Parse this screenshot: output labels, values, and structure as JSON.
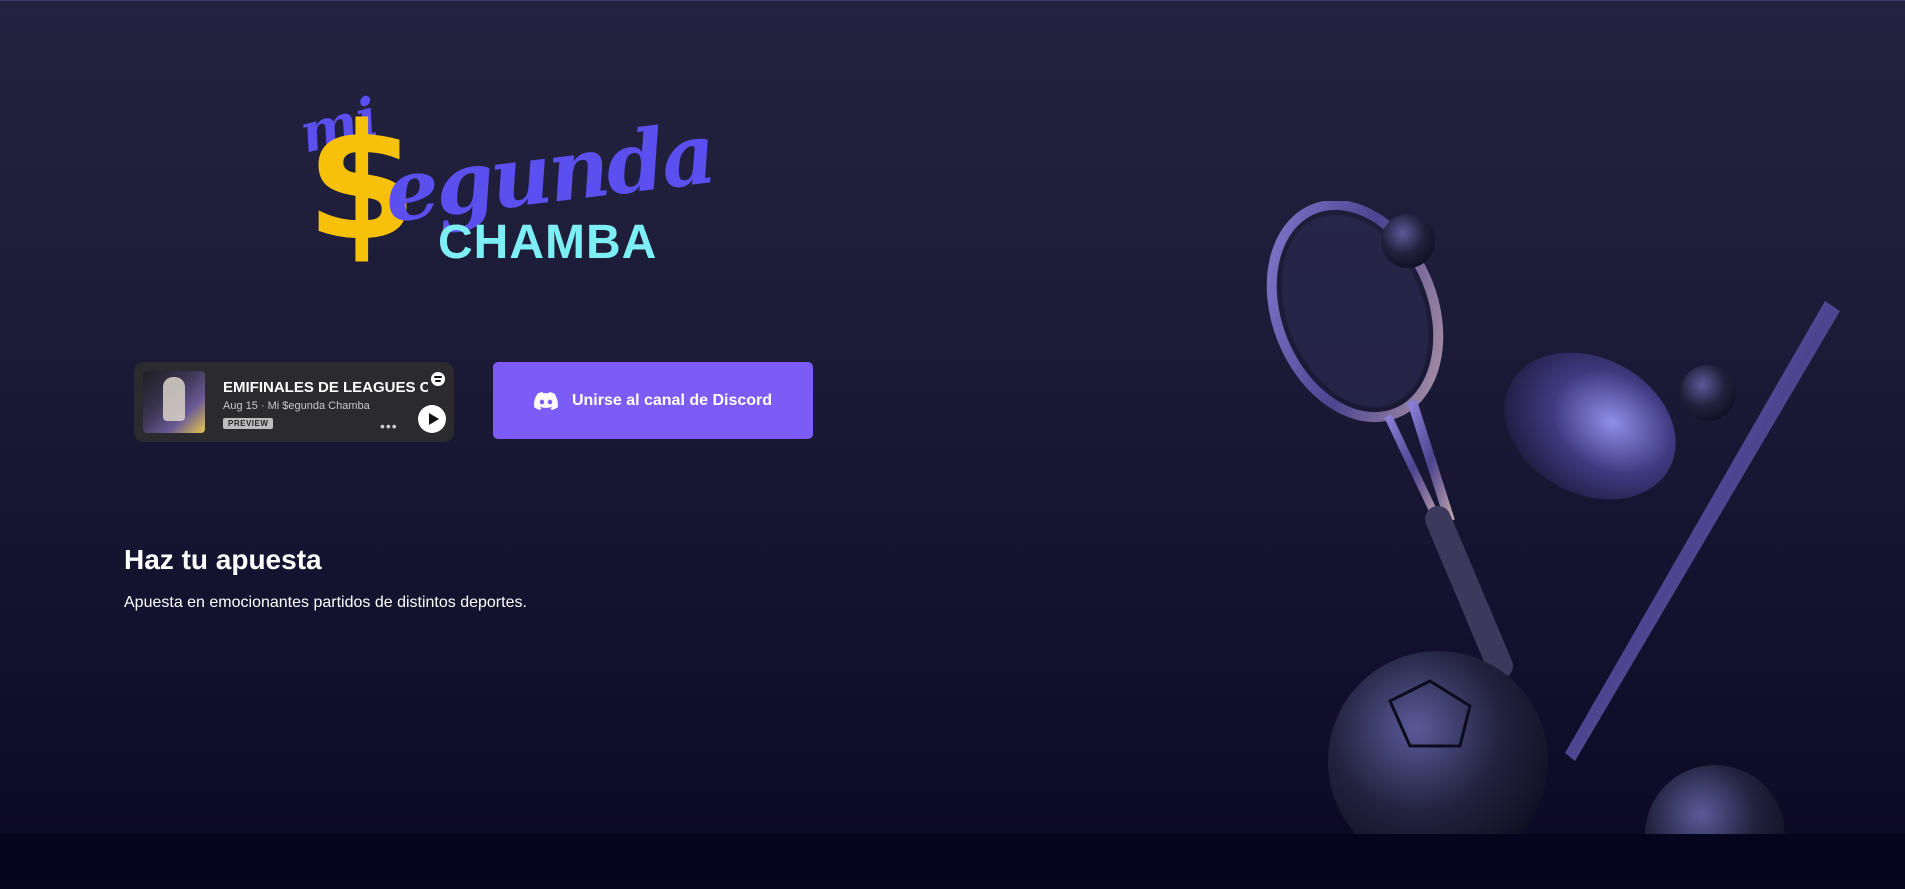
{
  "logo": {
    "mi": "mi",
    "dollar": "$",
    "segunda": "egunda",
    "chamba": "CHAMBA"
  },
  "spotify_embed": {
    "title": "EMIFINALES DE LEAGUES C",
    "meta": "Aug 15 · Mi $egunda Chamba",
    "preview_label": "PREVIEW",
    "more_label": "•••",
    "icons": [
      "spotify-icon",
      "play-icon"
    ]
  },
  "discord_button": {
    "label": "Unirse al canal de Discord",
    "icon": "discord-icon",
    "color": "#7b5cf7"
  },
  "section": {
    "heading": "Haz tu apuesta",
    "description": "Apuesta en emocionantes partidos de distintos deportes."
  },
  "colors": {
    "background": "#1b1a36",
    "footer": "#07041d",
    "logo_yellow": "#f6c108",
    "logo_purple": "#5b4ff0",
    "logo_cyan": "#7eeef5"
  }
}
